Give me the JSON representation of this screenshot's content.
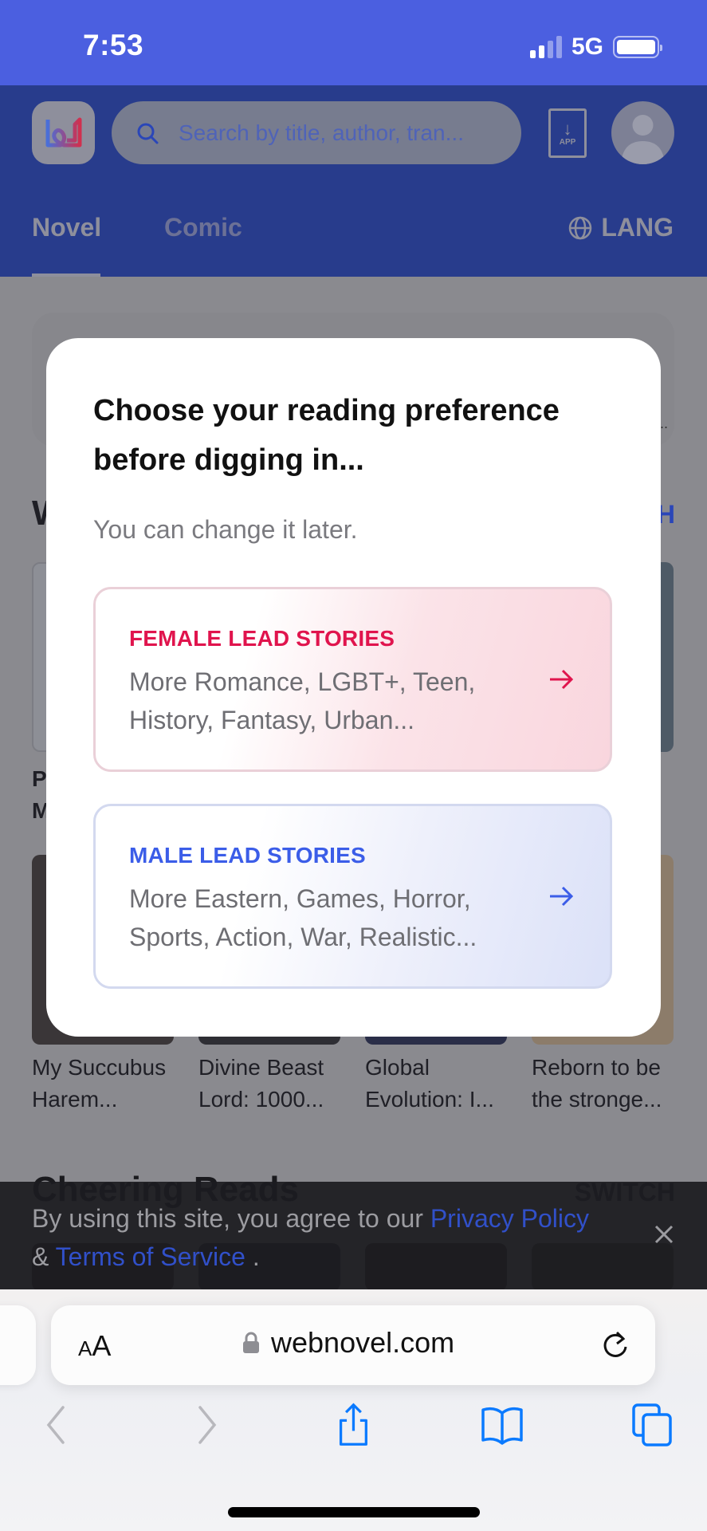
{
  "status_bar": {
    "time": "7:53",
    "network": "5G",
    "signal_bars": 4,
    "signal_active": 2
  },
  "header": {
    "logo_icon": "webnovel-logo-icon",
    "search_placeholder": "Search by title, author, tran...",
    "app_button_label": "APP",
    "tabs": [
      {
        "label": "Novel",
        "active": true
      },
      {
        "label": "Comic",
        "active": false
      }
    ],
    "lang_label": "LANG"
  },
  "background": {
    "section_title_partial": "W",
    "section_switch_partial": "H",
    "left_partial_lines": [
      "P",
      "M"
    ],
    "books": [
      {
        "title_line1": "My Succubus",
        "title_line2": "Harem..."
      },
      {
        "title_line1": "Divine Beast",
        "title_line2": "Lord: 1000..."
      },
      {
        "title_line1": "Global",
        "title_line2": "Evolution: I..."
      },
      {
        "title_line1": "Reborn to be",
        "title_line2": "the stronge..."
      }
    ],
    "section2_title": "Cheering Reads",
    "section2_switch": "SWITCH"
  },
  "modal": {
    "title": "Choose your reading preference before digging in...",
    "subtitle": "You can change it later.",
    "options": [
      {
        "label": "FEMALE LEAD STORIES",
        "description": "More Romance, LGBT+, Teen, History, Fantasy, Urban...",
        "accent": "#e0144d"
      },
      {
        "label": "MALE LEAD STORIES",
        "description": "More Eastern, Games, Horror, Sports, Action, War, Realistic...",
        "accent": "#3b5de8"
      }
    ]
  },
  "cookie_banner": {
    "text_before": "By using this site, you agree to our ",
    "privacy_link": "Privacy Policy",
    "ampersand": " & ",
    "terms_link": "Terms of Service",
    "text_after": " ."
  },
  "browser": {
    "text_size_small": "A",
    "text_size_large": "A",
    "url": "webnovel.com"
  },
  "colors": {
    "status_bar": "#4b5fe0",
    "female_accent": "#e0144d",
    "male_accent": "#3b5de8",
    "safari_blue": "#0a7aff"
  }
}
